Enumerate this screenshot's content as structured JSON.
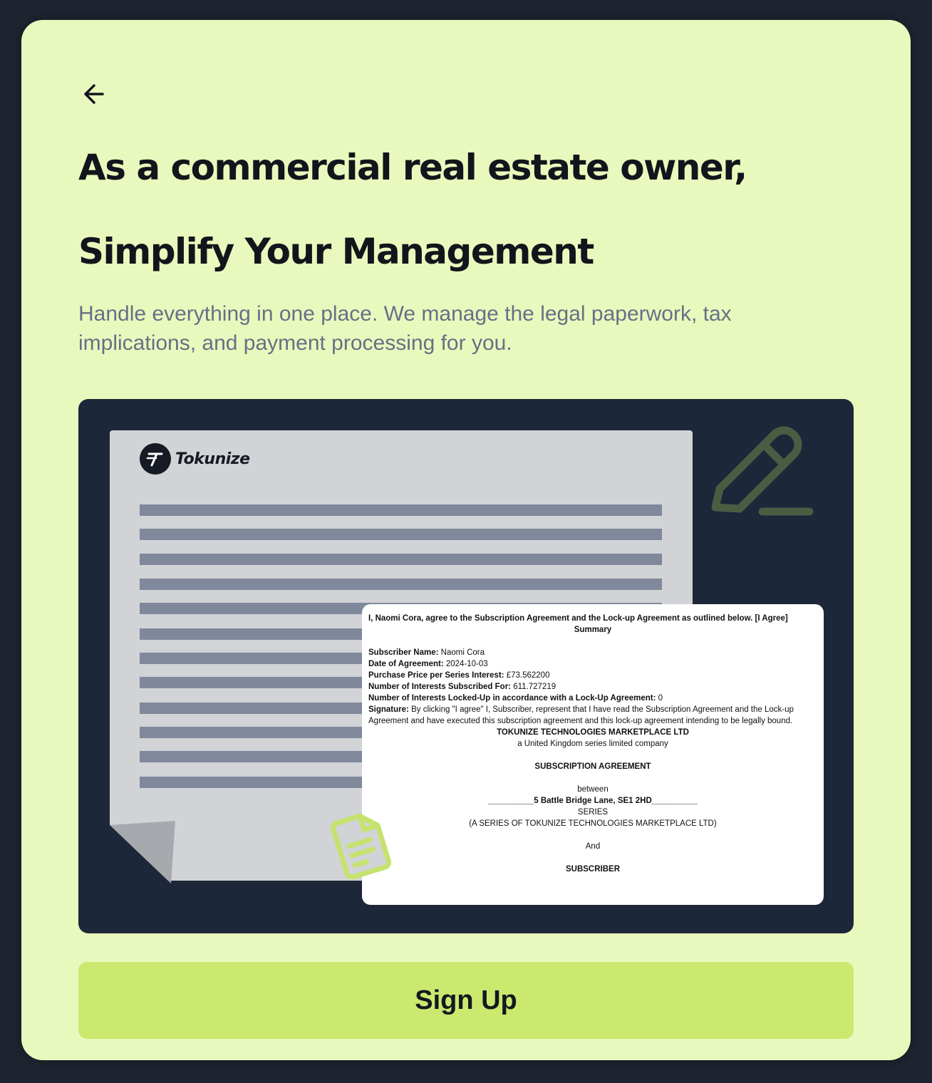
{
  "header": {
    "back_icon": "arrow-left-icon",
    "title_line1": "As a commercial real estate owner,",
    "title_line2": "Simplify Your Management",
    "subtitle": "Handle everything in one place. We manage the legal paperwork, tax implications, and payment processing for you."
  },
  "illustration": {
    "logo_text": "Tokunize",
    "pen_icon": "pen-icon",
    "document_icon": "document-icon"
  },
  "agreement": {
    "intro": "I, Naomi Cora, agree to the Subscription Agreement and the Lock-up Agreement as outlined below. [I Agree]",
    "summary_heading": "Summary",
    "fields": [
      {
        "label": "Subscriber Name:",
        "value": "Naomi Cora"
      },
      {
        "label": "Date of Agreement:",
        "value": "2024-10-03"
      },
      {
        "label": "Purchase Price per Series Interest:",
        "value": "£73.562200"
      },
      {
        "label": "Number of Interests Subscribed For:",
        "value": "611.727219"
      },
      {
        "label": "Number of Interests Locked-Up in accordance with a Lock-Up Agreement:",
        "value": "0"
      },
      {
        "label": "Signature:",
        "value": "By clicking \"I agree\" I, Subscriber, represent that I have read the Subscription Agreement and the Lock-up Agreement and have executed this subscription agreement and this lock-up agreement intending to be legally bound."
      }
    ],
    "company": "TOKUNIZE TECHNOLOGIES MARKETPLACE LTD",
    "company_desc": "a United Kingdom series limited company",
    "doc_title": "SUBSCRIPTION AGREEMENT",
    "between": "between",
    "series_name": "__________5 Battle Bridge Lane, SE1 2HD__________",
    "series": "SERIES",
    "series_of": "(A SERIES OF TOKUNIZE TECHNOLOGIES MARKETPLACE LTD)",
    "and": "And",
    "subscriber": "SUBSCRIBER"
  },
  "cta": {
    "signup_label": "Sign Up"
  },
  "colors": {
    "card_bg": "#e9f9bd",
    "panel_bg": "#1c2739",
    "button_bg": "#cce96f",
    "subtitle": "#667085",
    "accent_icon": "#c5e36c"
  }
}
